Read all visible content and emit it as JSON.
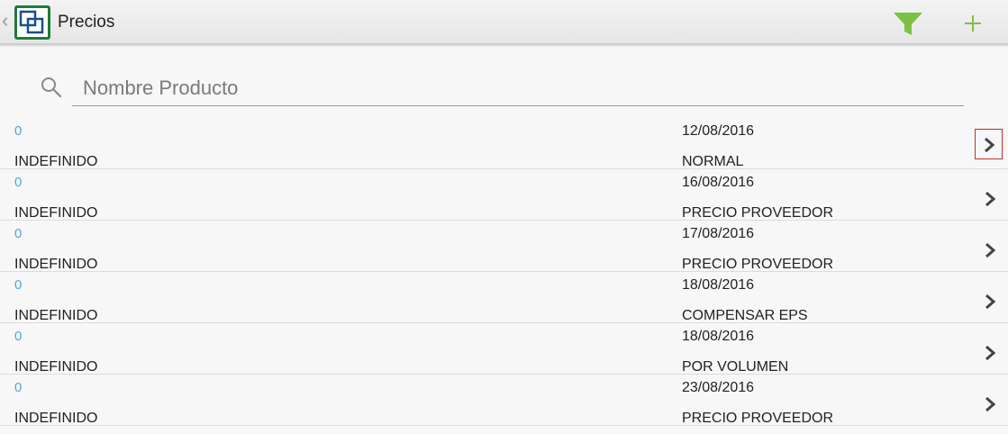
{
  "header": {
    "back_glyph": "‹",
    "title": "Precios",
    "app_icon": "app-logo-icon",
    "filter_icon": "filter-icon",
    "add_icon": "plus-icon",
    "colors": {
      "accent": "#7cc242",
      "logo": "#1f7a3b"
    }
  },
  "search": {
    "placeholder": "Nombre Producto",
    "value": ""
  },
  "list": {
    "items": [
      {
        "code": "0",
        "name": "INDEFINIDO",
        "date": "12/08/2016",
        "type": "NORMAL",
        "selected": true
      },
      {
        "code": "0",
        "name": "INDEFINIDO",
        "date": "16/08/2016",
        "type": "PRECIO PROVEEDOR",
        "selected": false
      },
      {
        "code": "0",
        "name": "INDEFINIDO",
        "date": "17/08/2016",
        "type": "PRECIO PROVEEDOR",
        "selected": false
      },
      {
        "code": "0",
        "name": "INDEFINIDO",
        "date": "18/08/2016",
        "type": "COMPENSAR EPS",
        "selected": false
      },
      {
        "code": "0",
        "name": "INDEFINIDO",
        "date": "18/08/2016",
        "type": "POR VOLUMEN",
        "selected": false
      },
      {
        "code": "0",
        "name": "INDEFINIDO",
        "date": "23/08/2016",
        "type": "PRECIO PROVEEDOR",
        "selected": false
      }
    ],
    "code_color": "#4fa9d6",
    "chevron_icon": "chevron-right-icon"
  }
}
